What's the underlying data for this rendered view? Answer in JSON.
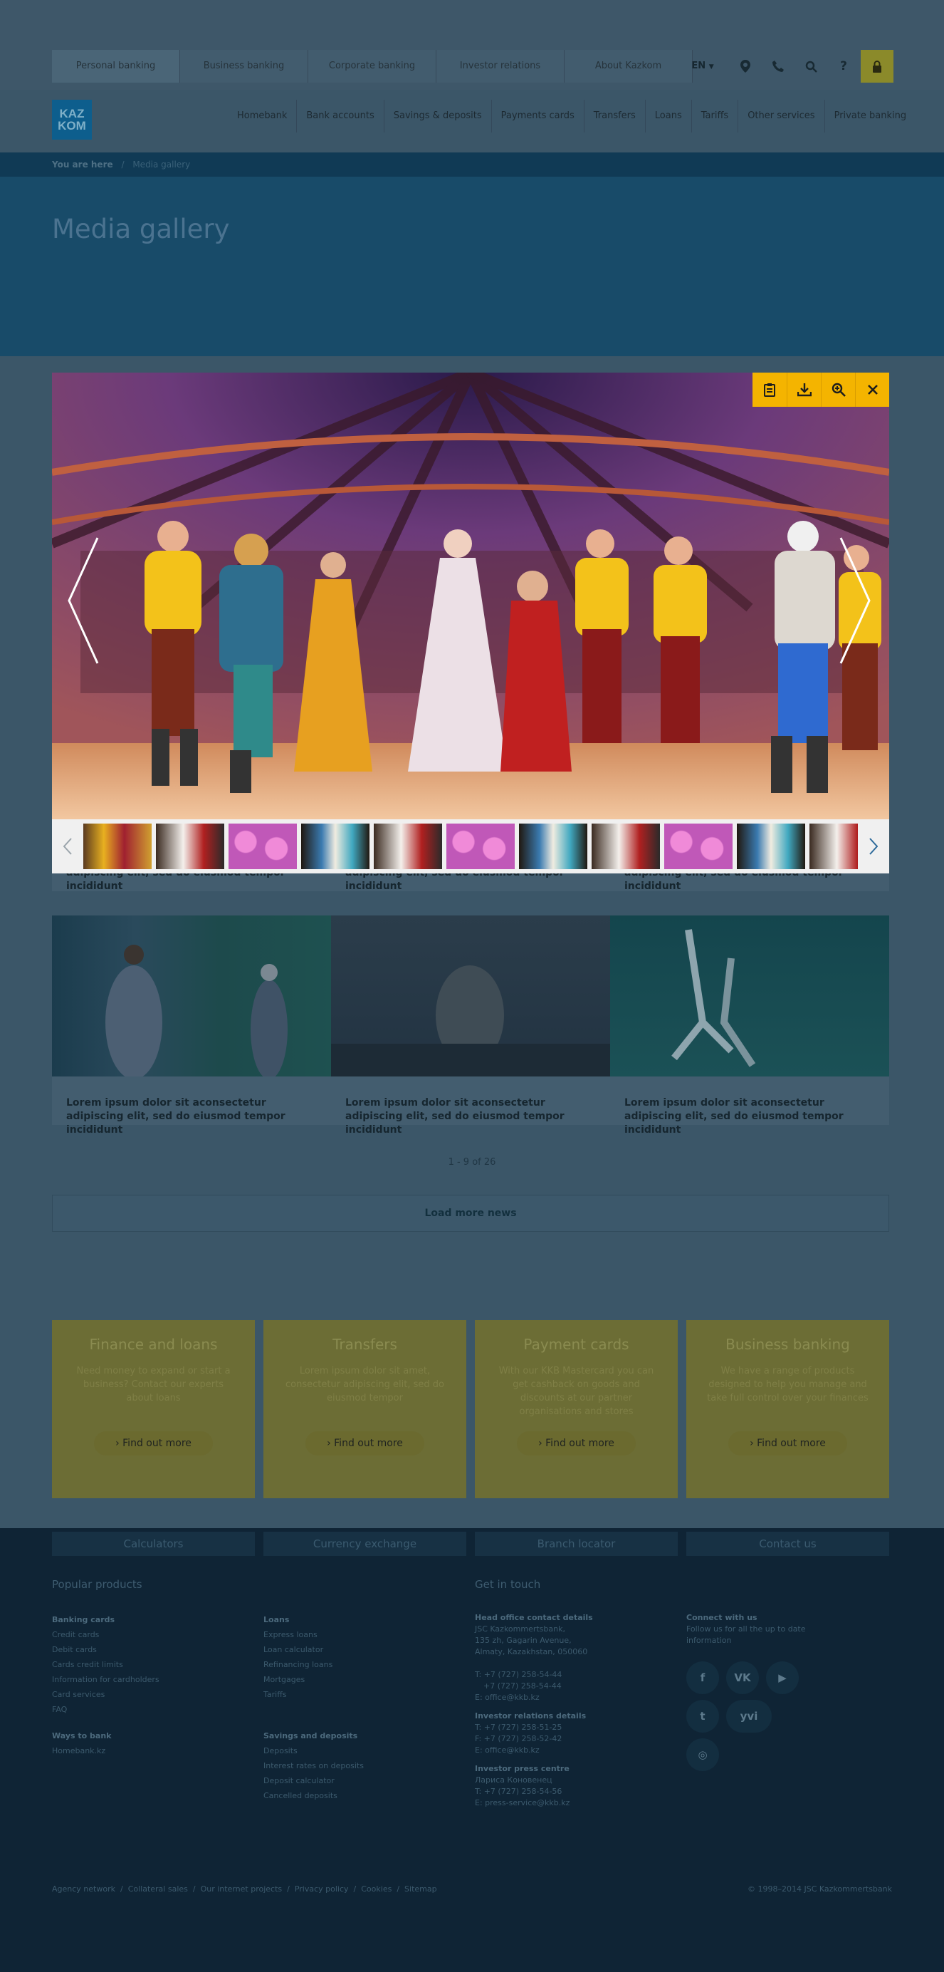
{
  "top_nav": [
    "Personal banking",
    "Business banking",
    "Corporate banking",
    "Investor relations",
    "About Kazkom"
  ],
  "lang": "EN",
  "main_nav": [
    "Homebank",
    "Bank accounts",
    "Savings & deposits",
    "Payments cards",
    "Transfers",
    "Loans",
    "Tariffs",
    "Other services",
    "Private banking"
  ],
  "logo": {
    "line1": "KAZ",
    "line2": "KOM"
  },
  "breadcrumb": {
    "label": "You are here",
    "separator": "/",
    "current": "Media gallery"
  },
  "page_title": "Media gallery",
  "captions": [
    "Lorem ipsum dolor sit aconsectetur adipiscing elit, sed do eiusmod tempor incididunt",
    "Lorem ipsum dolor sit aconsectetur adipiscing elit, sed do eiusmod tempor incididunt",
    "Lorem ipsum dolor sit aconsectetur adipiscing elit, sed do eiusmod tempor incididunt",
    "Lorem ipsum dolor sit aconsectetur adipiscing elit, sed do eiusmod tempor incididunt",
    "Lorem ipsum dolor sit aconsectetur adipiscing elit, sed do eiusmod tempor incididunt",
    "Lorem ipsum dolor sit aconsectetur adipiscing elit, sed do eiusmod tempor incididunt"
  ],
  "pager": "1 - 9 of 26",
  "load_more": "Load more news",
  "promos": [
    {
      "title": "Finance and loans",
      "text": "Need money to expand or start a business? Contact our experts about loans",
      "button": "Find out more"
    },
    {
      "title": "Transfers",
      "text": "Lorem ipsum dolor sit amet, consectetur adipiscing elit, sed do eiusmod tempor",
      "button": "Find out more"
    },
    {
      "title": "Payment cards",
      "text": "With our KKB Mastercard you can get cashback on goods and discounts at our partner organisations and stores",
      "button": "Find out more"
    },
    {
      "title": "Business banking",
      "text": "We have a range of products designed to help you manage and take full control over your finances",
      "button": "Find out more"
    }
  ],
  "tool_links": [
    "Calculators",
    "Currency exchange",
    "Branch locator",
    "Contact us"
  ],
  "footer": {
    "popular_title": "Popular products",
    "get_in_touch_title": "Get in touch",
    "banking_cards": {
      "title": "Banking cards",
      "items": [
        "Credit cards",
        "Debit cards",
        "Cards credit limits",
        "Information for cardholders",
        "Card services",
        "FAQ"
      ]
    },
    "ways": {
      "title": "Ways to bank",
      "items": [
        "Homebank.kz"
      ]
    },
    "loans": {
      "title": "Loans",
      "items": [
        "Express loans",
        "Loan calculator",
        "Refinancing loans",
        "Mortgages",
        "Tariffs"
      ]
    },
    "savings": {
      "title": "Savings and deposits",
      "items": [
        "Deposits",
        "Interest rates on deposits",
        "Deposit calculator",
        "Cancelled deposits"
      ]
    },
    "head_office": {
      "title": "Head office contact details",
      "lines": [
        "JSC Kazkommertsbank,",
        "135 zh, Gagarin Avenue,",
        "Almaty, Kazakhstan, 050060"
      ],
      "phones": [
        "T: +7 (727) 258-54-44",
        "+7 (727) 258-54-44",
        "E: office@kkb.kz"
      ]
    },
    "investor": {
      "title": "Investor relations details",
      "lines": [
        "T: +7 (727) 258-51-25",
        "F: +7 (727) 258-52-42",
        "E: office@kkb.kz"
      ]
    },
    "press": {
      "title": "Investor press centre",
      "lines": [
        "Лариса Коновенец",
        "T: +7 (727) 258-54-56",
        "E: press-service@kkb.kz"
      ]
    },
    "connect": {
      "title": "Connect with us",
      "text": "Follow us for all the up to date information"
    },
    "social": [
      "f",
      "VK",
      "▶",
      "t",
      "yvi",
      "◎"
    ],
    "bottom_links": [
      "Agency network",
      "Collateral sales",
      "Our internet projects",
      "Privacy policy",
      "Cookies",
      "Sitemap"
    ],
    "copyright": "© 1998–2014 JSC Kazkommertsbank"
  }
}
